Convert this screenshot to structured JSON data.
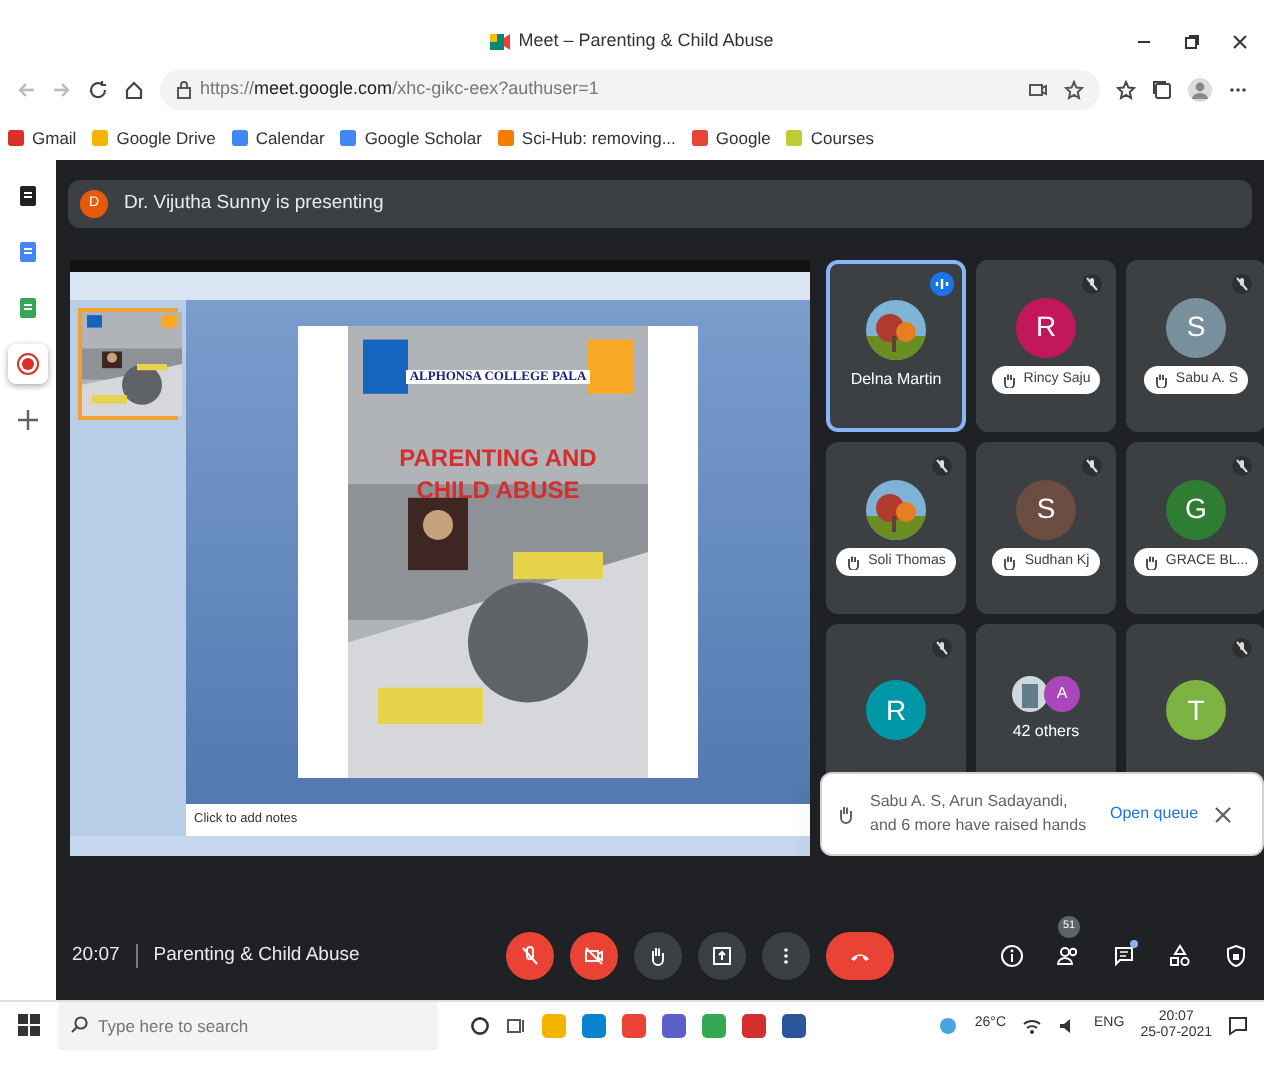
{
  "browser": {
    "title": "Meet – Parenting & Child Abuse",
    "url": {
      "scheme": "https://",
      "host": "meet.google.com",
      "path": "/xhc-gikc-eex?authuser=1"
    }
  },
  "bookmarks": [
    {
      "label": "Gmail",
      "color": "#d93025"
    },
    {
      "label": "Google Drive",
      "color": "#f4b400"
    },
    {
      "label": "Calendar",
      "color": "#4285f4"
    },
    {
      "label": "Google Scholar",
      "color": "#4285f4"
    },
    {
      "label": "Sci-Hub: removing...",
      "color": "#f57c00"
    },
    {
      "label": "Google",
      "color": "#ea4335"
    },
    {
      "label": "Courses",
      "color": "#c0ca33"
    }
  ],
  "side_panel": [
    {
      "kind": "doc",
      "color": "#202124",
      "selected": false
    },
    {
      "kind": "doc",
      "color": "#4285f4",
      "selected": false
    },
    {
      "kind": "doc",
      "color": "#34a853",
      "selected": false
    },
    {
      "kind": "record",
      "color": "#d93025",
      "selected": true
    },
    {
      "kind": "add",
      "color": "#5f6368",
      "selected": false
    }
  ],
  "presenter": {
    "initial": "D",
    "text": "Dr. Vijutha Sunny is presenting"
  },
  "slide": {
    "college": "ALPHONSA COLLEGE PALA",
    "headline": [
      "PARENTING AND",
      "CHILD ABUSE"
    ],
    "notes_placeholder": "Click to add notes"
  },
  "participants": [
    {
      "name": "Delna Martin",
      "speaking": true,
      "muted": false,
      "hand_raised": false
    },
    {
      "kind": "initial",
      "initial": "R",
      "color": "#c2185b",
      "name": "Rincy Saju",
      "speaking": false,
      "muted": true,
      "hand_raised": true
    },
    {
      "kind": "initial",
      "initial": "S",
      "color": "#78909c",
      "name": "Sabu A. S",
      "speaking": false,
      "muted": true,
      "hand_raised": true
    },
    {
      "name": "Soli Thomas",
      "speaking": false,
      "muted": true,
      "hand_raised": true
    },
    {
      "kind": "initial",
      "initial": "S",
      "color": "#6d4c41",
      "name": "Sudhan Kj",
      "speaking": false,
      "muted": true,
      "hand_raised": true
    },
    {
      "kind": "initial",
      "initial": "G",
      "color": "#2e7d32",
      "name": "GRACE BL...",
      "speaking": false,
      "muted": true,
      "hand_raised": true
    },
    {
      "kind": "initial",
      "initial": "R",
      "color": "#0097a7",
      "speaking": false,
      "muted": true
    },
    {
      "kind": "others",
      "initial": "A",
      "color": "#ab47bc",
      "name": "42 others",
      "speaking": false,
      "muted": false,
      "hand_raised": false
    },
    {
      "kind": "initial",
      "initial": "T",
      "color": "#7cb342",
      "speaking": false,
      "muted": true
    }
  ],
  "toast": {
    "text": "Sabu A. S, Arun Sadayandi, and 6 more have raised hands",
    "action": "Open queue"
  },
  "meeting": {
    "time": "20:07",
    "title": "Parenting & Child Abuse"
  },
  "controls": [
    {
      "kind": "mic",
      "on": false
    },
    {
      "kind": "camera",
      "on": false
    },
    {
      "kind": "hand",
      "on": false
    },
    {
      "kind": "present",
      "on": false
    },
    {
      "kind": "more",
      "on": false
    },
    {
      "kind": "end"
    }
  ],
  "side_controls": [
    {
      "kind": "info"
    },
    {
      "kind": "people",
      "badge": "51"
    },
    {
      "kind": "chat",
      "dot": true
    },
    {
      "kind": "activities"
    },
    {
      "kind": "safety"
    }
  ],
  "taskbar": {
    "search_placeholder": "Type here to search",
    "apps": [
      {
        "color": "#f4b400"
      },
      {
        "color": "#0a84d0"
      },
      {
        "color": "#ea4335"
      },
      {
        "color": "#5b5fc7"
      },
      {
        "color": "#34a853"
      },
      {
        "color": "#d32f2f"
      },
      {
        "color": "#2b579a"
      }
    ],
    "temperature": "26°C",
    "language": "ENG",
    "time": "20:07",
    "date": "25-07-2021"
  }
}
